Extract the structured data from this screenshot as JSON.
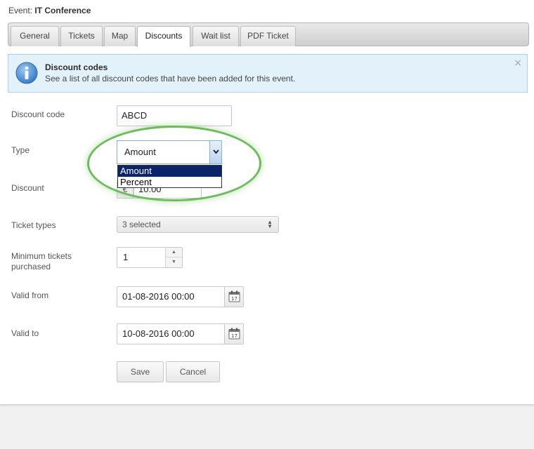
{
  "event": {
    "prefix": "Event:",
    "name": "IT Conference"
  },
  "tabs": [
    {
      "label": "General"
    },
    {
      "label": "Tickets"
    },
    {
      "label": "Map"
    },
    {
      "label": "Discounts",
      "active": true
    },
    {
      "label": "Wait list"
    },
    {
      "label": "PDF Ticket"
    }
  ],
  "info": {
    "title": "Discount codes",
    "text": "See a list of all discount codes that have been added for this event.",
    "close": "×",
    "icon": "info-icon"
  },
  "form": {
    "discount_code": {
      "label": "Discount code",
      "value": "ABCD"
    },
    "type": {
      "label": "Type",
      "value": "Amount",
      "options": [
        "Amount",
        "Percent"
      ],
      "highlighted": "Amount"
    },
    "discount": {
      "label": "Discount",
      "currency": "€",
      "value": "10.00"
    },
    "ticket_types": {
      "label": "Ticket types",
      "value": "3 selected"
    },
    "min_tickets": {
      "label_line1": "Minimum tickets",
      "label_line2": "purchased",
      "value": "1"
    },
    "valid_from": {
      "label": "Valid from",
      "value": "01-08-2016 00:00",
      "calendar_day": "17"
    },
    "valid_to": {
      "label": "Valid to",
      "value": "10-08-2016 00:00",
      "calendar_day": "17"
    }
  },
  "buttons": {
    "save": "Save",
    "cancel": "Cancel"
  },
  "colors": {
    "highlight_ring": "#6cbd5a",
    "info_bg": "#e3f2fa",
    "dropdown_selected": "#0a246a"
  }
}
